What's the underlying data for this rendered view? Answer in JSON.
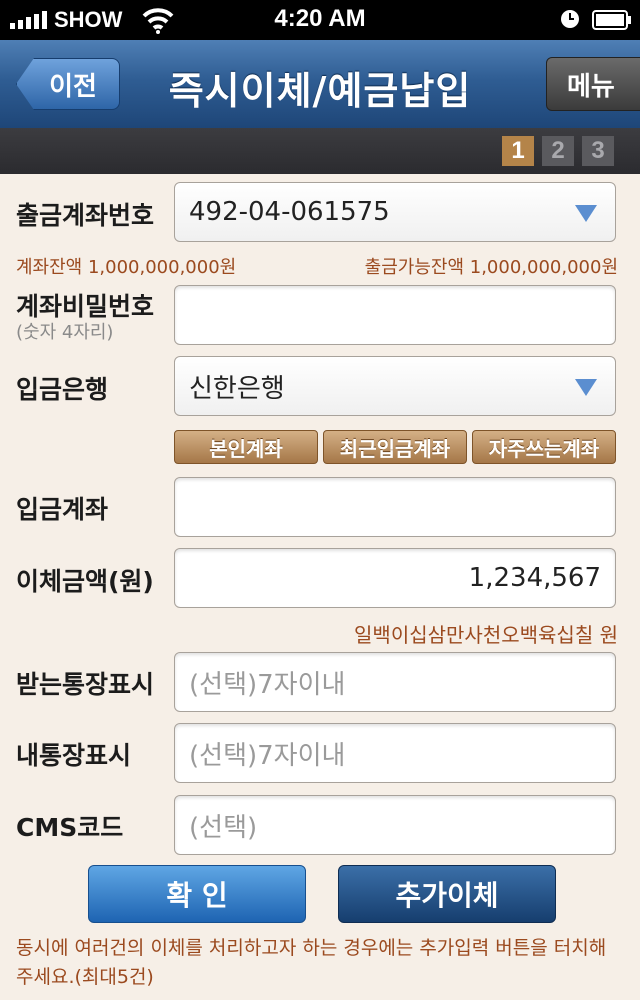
{
  "status": {
    "carrier": "SHOW",
    "time": "4:20 AM"
  },
  "nav": {
    "back_label": "이전",
    "title": "즉시이체/예금납입",
    "menu_label": "메뉴"
  },
  "steps": [
    "1",
    "2",
    "3"
  ],
  "current_step": 1,
  "form": {
    "account": {
      "label": "출금계좌번호",
      "value": "492-04-061575"
    },
    "balance_text": "계좌잔액 1,000,000,000원",
    "available_text": "출금가능잔액 1,000,000,000원",
    "password": {
      "label": "계좌비밀번호",
      "sublabel": "(숫자 4자리)",
      "value": ""
    },
    "bank": {
      "label": "입금은행",
      "value": "신한은행"
    },
    "quick_buttons": [
      "본인계좌",
      "최근입금계좌",
      "자주쓰는계좌"
    ],
    "deposit_account": {
      "label": "입금계좌",
      "value": ""
    },
    "amount": {
      "label": "이체금액(원)",
      "value": "1,234,567",
      "korean_text": "일백이십삼만사천오백육십칠 원"
    },
    "recipient_memo": {
      "label": "받는통장표시",
      "placeholder": "(선택)7자이내"
    },
    "my_memo": {
      "label": "내통장표시",
      "placeholder": "(선택)7자이내"
    },
    "cms": {
      "label": "CMS코드",
      "placeholder": "(선택)"
    }
  },
  "buttons": {
    "confirm": "확 인",
    "add_transfer": "추가이체"
  },
  "notice": "동시에 여러건의 이체를 처리하고자 하는 경우에는 추가입력 버튼을 터치해 주세요.(최대5건)"
}
